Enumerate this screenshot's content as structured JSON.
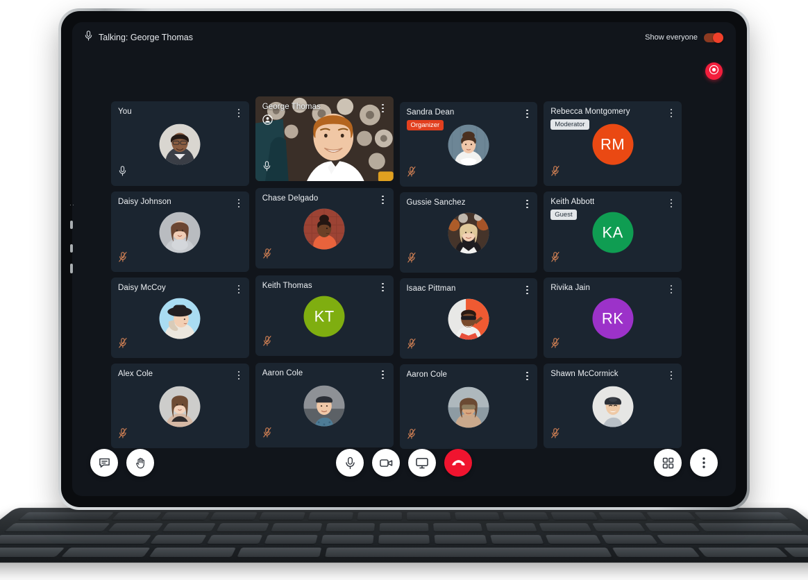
{
  "topbar": {
    "mic_icon": "microphone-icon",
    "talking_label": "Talking: George Thomas",
    "show_everyone_label": "Show everyone",
    "show_everyone_state": "on",
    "record_icon": "record-target-icon"
  },
  "colors": {
    "app_background": "#11151b",
    "tile_background": "#1b2530",
    "accent_red": "#f0142f",
    "organizer_badge": "#e2401f",
    "toggle_on": "#f0402a",
    "muted_icon": "#d98455",
    "unmuted_icon": "#d8dde2"
  },
  "grid": {
    "columns": 4,
    "rows": 4,
    "participants": [
      {
        "name": "You",
        "badge": null,
        "avatar": "photo",
        "avatar_kind": "woman-glasses-suit",
        "muted": false,
        "video": false,
        "speaking": false,
        "col": 1,
        "row": 1
      },
      {
        "name": "Daisy Johnson",
        "badge": null,
        "avatar": "photo",
        "avatar_kind": "woman-grey-scarf",
        "muted": true,
        "video": false,
        "speaking": false,
        "col": 1,
        "row": 2
      },
      {
        "name": "Daisy McCoy",
        "badge": null,
        "avatar": "photo",
        "avatar_kind": "woman-black-hat",
        "muted": true,
        "video": false,
        "speaking": false,
        "col": 1,
        "row": 3
      },
      {
        "name": "Alex Cole",
        "badge": null,
        "avatar": "photo",
        "avatar_kind": "woman-long-hair",
        "muted": true,
        "video": false,
        "speaking": false,
        "col": 1,
        "row": 4
      },
      {
        "name": "George Thomas",
        "badge": null,
        "avatar": "video",
        "avatar_kind": "man-white-shirt",
        "muted": false,
        "video": true,
        "speaking": true,
        "col": 2,
        "row": 1
      },
      {
        "name": "Chase Delgado",
        "badge": null,
        "avatar": "photo",
        "avatar_kind": "woman-orange-brick",
        "muted": true,
        "video": false,
        "speaking": false,
        "col": 2,
        "row": 2
      },
      {
        "name": "Keith Thomas",
        "badge": null,
        "avatar": "initials",
        "initials": "KT",
        "initials_color": "#7fae10",
        "muted": true,
        "video": false,
        "speaking": false,
        "col": 2,
        "row": 3
      },
      {
        "name": "Aaron Cole",
        "badge": null,
        "avatar": "photo",
        "avatar_kind": "man-cap-backwards",
        "muted": true,
        "video": false,
        "speaking": false,
        "col": 2,
        "row": 4
      },
      {
        "name": "Sandra Dean",
        "badge": "Organizer",
        "badge_type": "organizer",
        "avatar": "photo",
        "avatar_kind": "woman-updo-white-top",
        "muted": true,
        "video": false,
        "speaking": false,
        "col": 3,
        "row": 1
      },
      {
        "name": "Gussie Sanchez",
        "badge": null,
        "avatar": "photo",
        "avatar_kind": "woman-blonde-autumn",
        "muted": true,
        "video": false,
        "speaking": false,
        "col": 3,
        "row": 2
      },
      {
        "name": "Isaac Pittman",
        "badge": null,
        "avatar": "photo",
        "avatar_kind": "man-sunglasses-red",
        "muted": true,
        "video": false,
        "speaking": false,
        "col": 3,
        "row": 3
      },
      {
        "name": "Aaron Cole",
        "badge": null,
        "avatar": "photo",
        "avatar_kind": "woman-sunglasses-beach",
        "muted": true,
        "video": false,
        "speaking": false,
        "col": 3,
        "row": 4
      },
      {
        "name": "Rebecca Montgomery",
        "badge": "Moderator",
        "badge_type": "moderator",
        "avatar": "initials",
        "initials": "RM",
        "initials_color": "#ea4913",
        "muted": true,
        "video": false,
        "speaking": false,
        "col": 4,
        "row": 1
      },
      {
        "name": "Keith Abbott",
        "badge": "Guest",
        "badge_type": "guest",
        "avatar": "initials",
        "initials": "KA",
        "initials_color": "#0f9d52",
        "muted": true,
        "video": false,
        "speaking": false,
        "col": 4,
        "row": 2
      },
      {
        "name": "Rivika Jain",
        "badge": null,
        "avatar": "initials",
        "initials": "RK",
        "initials_color": "#9c32c9",
        "muted": true,
        "video": false,
        "speaking": false,
        "col": 4,
        "row": 3
      },
      {
        "name": "Shawn McCormick",
        "badge": null,
        "avatar": "photo",
        "avatar_kind": "man-grey-cap",
        "muted": true,
        "video": false,
        "speaking": false,
        "col": 4,
        "row": 4
      }
    ]
  },
  "toolbar": {
    "left": [
      {
        "name": "chat-button",
        "icon": "chat-bubble-icon",
        "style": "light"
      },
      {
        "name": "raise-hand-button",
        "icon": "raised-hand-icon",
        "style": "light"
      }
    ],
    "center": [
      {
        "name": "microphone-button",
        "icon": "microphone-icon",
        "style": "light"
      },
      {
        "name": "camera-button",
        "icon": "video-camera-icon",
        "style": "light"
      },
      {
        "name": "share-screen-button",
        "icon": "monitor-icon",
        "style": "light"
      },
      {
        "name": "end-call-button",
        "icon": "phone-hangup-icon",
        "style": "danger"
      }
    ],
    "right": [
      {
        "name": "layout-grid-button",
        "icon": "grid-squares-icon",
        "style": "light"
      },
      {
        "name": "more-options-button",
        "icon": "kebab-menu-icon",
        "style": "light"
      }
    ]
  }
}
